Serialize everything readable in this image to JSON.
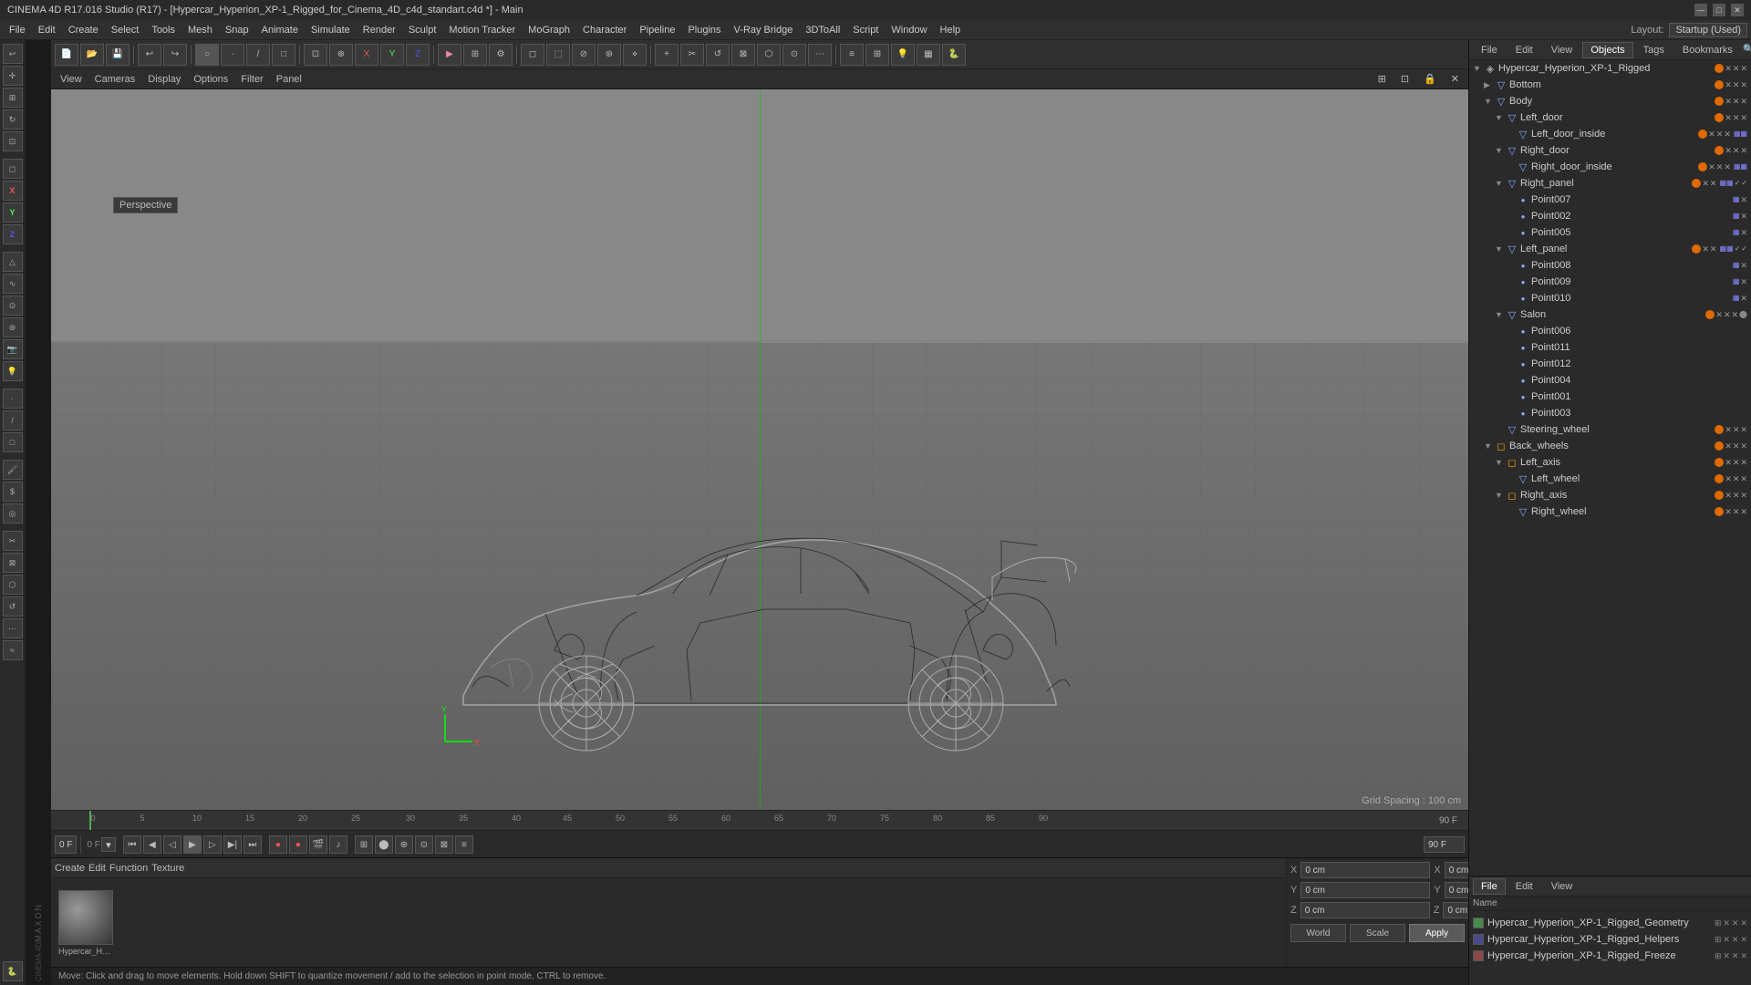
{
  "title": "CINEMA 4D R17.016 Studio (R17) - [Hypercar_Hyperion_XP-1_Rigged_for_Cinema_4D_c4d_standart.c4d *] - Main",
  "window_controls": {
    "minimize": "—",
    "maximize": "□",
    "close": "✕"
  },
  "menu": {
    "items": [
      "File",
      "Edit",
      "Create",
      "Select",
      "Tools",
      "Mesh",
      "Snap",
      "Animate",
      "Simulate",
      "Render",
      "Sculpt",
      "Motion Tracker",
      "MoGraph",
      "Character",
      "Pipeline",
      "Plugins",
      "V-Ray Bridge",
      "3DToAll",
      "Script",
      "Window",
      "Help"
    ]
  },
  "layout_label": "Layout:",
  "layout_value": "Startup (Used)",
  "viewport": {
    "label": "Perspective",
    "menu_items": [
      "View",
      "Cameras",
      "Display",
      "Options",
      "Filter",
      "Panel"
    ],
    "grid_spacing": "Grid Spacing : 100 cm"
  },
  "object_tree": {
    "root": "Hypercar_Hyperion_XP-1_Rigged",
    "items": [
      {
        "name": "Bottom",
        "level": 1,
        "type": "geo",
        "has_children": false
      },
      {
        "name": "Body",
        "level": 1,
        "type": "geo",
        "has_children": true
      },
      {
        "name": "Left_door",
        "level": 2,
        "type": "geo",
        "has_children": false
      },
      {
        "name": "Left_door_inside",
        "level": 3,
        "type": "geo",
        "has_children": false
      },
      {
        "name": "Right_door",
        "level": 2,
        "type": "geo",
        "has_children": false
      },
      {
        "name": "Right_door_inside",
        "level": 3,
        "type": "geo",
        "has_children": false
      },
      {
        "name": "Right_panel",
        "level": 2,
        "type": "geo",
        "has_children": false
      },
      {
        "name": "Point007",
        "level": 3,
        "type": "point",
        "has_children": false
      },
      {
        "name": "Point002",
        "level": 3,
        "type": "point",
        "has_children": false
      },
      {
        "name": "Point005",
        "level": 3,
        "type": "point",
        "has_children": false
      },
      {
        "name": "Left_panel",
        "level": 2,
        "type": "geo",
        "has_children": false
      },
      {
        "name": "Point008",
        "level": 3,
        "type": "point",
        "has_children": false
      },
      {
        "name": "Point009",
        "level": 3,
        "type": "point",
        "has_children": false
      },
      {
        "name": "Point010",
        "level": 3,
        "type": "point",
        "has_children": false
      },
      {
        "name": "Salon",
        "level": 2,
        "type": "geo",
        "has_children": true
      },
      {
        "name": "Point006",
        "level": 3,
        "type": "point",
        "has_children": false
      },
      {
        "name": "Point011",
        "level": 3,
        "type": "point",
        "has_children": false
      },
      {
        "name": "Point012",
        "level": 3,
        "type": "point",
        "has_children": false
      },
      {
        "name": "Point004",
        "level": 3,
        "type": "point",
        "has_children": false
      },
      {
        "name": "Point001",
        "level": 3,
        "type": "point",
        "has_children": false
      },
      {
        "name": "Point003",
        "level": 3,
        "type": "point",
        "has_children": false
      },
      {
        "name": "Steering_wheel",
        "level": 2,
        "type": "geo",
        "has_children": false
      },
      {
        "name": "Back_wheels",
        "level": 1,
        "type": "null",
        "has_children": true
      },
      {
        "name": "Left_axis",
        "level": 2,
        "type": "null",
        "has_children": true
      },
      {
        "name": "Left_wheel",
        "level": 3,
        "type": "geo",
        "has_children": false
      },
      {
        "name": "Right_axis",
        "level": 2,
        "type": "null",
        "has_children": true
      },
      {
        "name": "Right_wheel",
        "level": 3,
        "type": "geo",
        "has_children": false
      }
    ]
  },
  "tabs": {
    "right_top": [
      "File",
      "Edit",
      "View",
      "Objects",
      "Tags",
      "Bookmarks"
    ],
    "right_bottom": [
      "File",
      "Edit",
      "View"
    ]
  },
  "lower_right": {
    "items": [
      {
        "name": "Hypercar_Hyperion_XP-1_Rigged_Geometry",
        "color": "#4a8a4a"
      },
      {
        "name": "Hypercar_Hyperion_XP-1_Rigged_Helpers",
        "color": "#4a4a8a"
      },
      {
        "name": "Hypercar_Hyperion_XP-1_Rigged_Freeze",
        "color": "#8a4a4a"
      }
    ]
  },
  "lower_right_label": "Name",
  "coords": {
    "x_pos": "0 cm",
    "y_pos": "0 cm",
    "z_pos": "0 cm",
    "x_size": "0 cm",
    "y_size": "0 cm",
    "z_size": "0 cm"
  },
  "coord_labels": {
    "x": "X",
    "y": "Y",
    "z": "Z"
  },
  "buttons": {
    "world": "World",
    "scale": "Scale",
    "apply": "Apply"
  },
  "timeline": {
    "current_frame": "0 F",
    "end_frame": "90 F",
    "ticks": [
      "0",
      "5",
      "10",
      "15",
      "20",
      "25",
      "30",
      "35",
      "40",
      "45",
      "50",
      "55",
      "60",
      "65",
      "70",
      "75",
      "80",
      "85",
      "90"
    ]
  },
  "status_bar": {
    "text": "Move: Click and drag to move elements. Hold down SHIFT to quantize movement / add to the selection in point mode, CTRL to remove."
  },
  "materials": {
    "toolbar_items": [
      "Create",
      "Edit",
      "Function",
      "Texture"
    ]
  }
}
